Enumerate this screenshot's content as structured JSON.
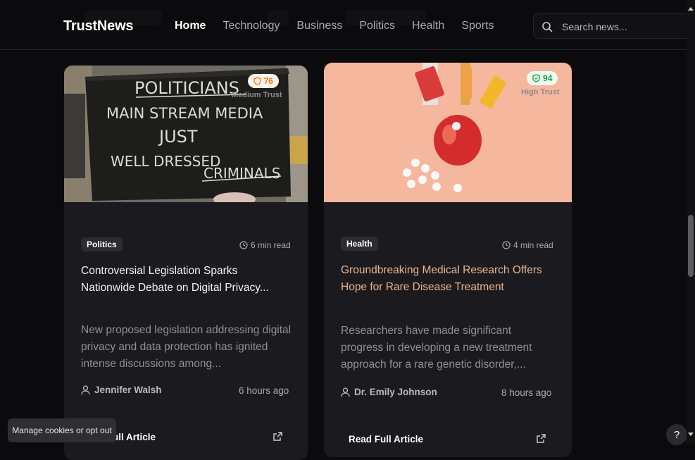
{
  "header": {
    "brand": "TrustNews",
    "nav": [
      {
        "label": "Home",
        "active": true
      },
      {
        "label": "Technology"
      },
      {
        "label": "Business"
      },
      {
        "label": "Politics"
      },
      {
        "label": "Health"
      },
      {
        "label": "Sports"
      }
    ],
    "search_placeholder": "Search news..."
  },
  "articles": [
    {
      "trust_score": "76",
      "trust_label": "Medium Trust",
      "trust_color": "#f97316",
      "image_sign_lines": [
        "POLITICIANS",
        "MAIN STREAM MEDIA",
        "JUST",
        "WELL DRESSED",
        "CRIMINALS"
      ],
      "category": "Politics",
      "read_time": "6 min read",
      "title": "Controversial Legislation Sparks Nationwide Debate on Digital Privacy...",
      "excerpt": "New proposed legislation addressing digital privacy and data protection has ignited intense discussions among...",
      "author": "Jennifer Walsh",
      "time_ago": "6 hours ago",
      "cta": "Read Full Article"
    },
    {
      "trust_score": "94",
      "trust_label": "High Trust",
      "trust_color": "#16a34a",
      "category": "Health",
      "read_time": "4 min read",
      "title": "Groundbreaking Medical Research Offers Hope for Rare Disease Treatment",
      "title_color": "#e9b48f",
      "excerpt": "Researchers have made significant progress in developing a new treatment approach for a rare genetic disorder,...",
      "author": "Dr. Emily Johnson",
      "time_ago": "8 hours ago",
      "cta": "Read Full Article"
    }
  ],
  "cookie_button": "Manage cookies or opt out",
  "help_button": "?"
}
